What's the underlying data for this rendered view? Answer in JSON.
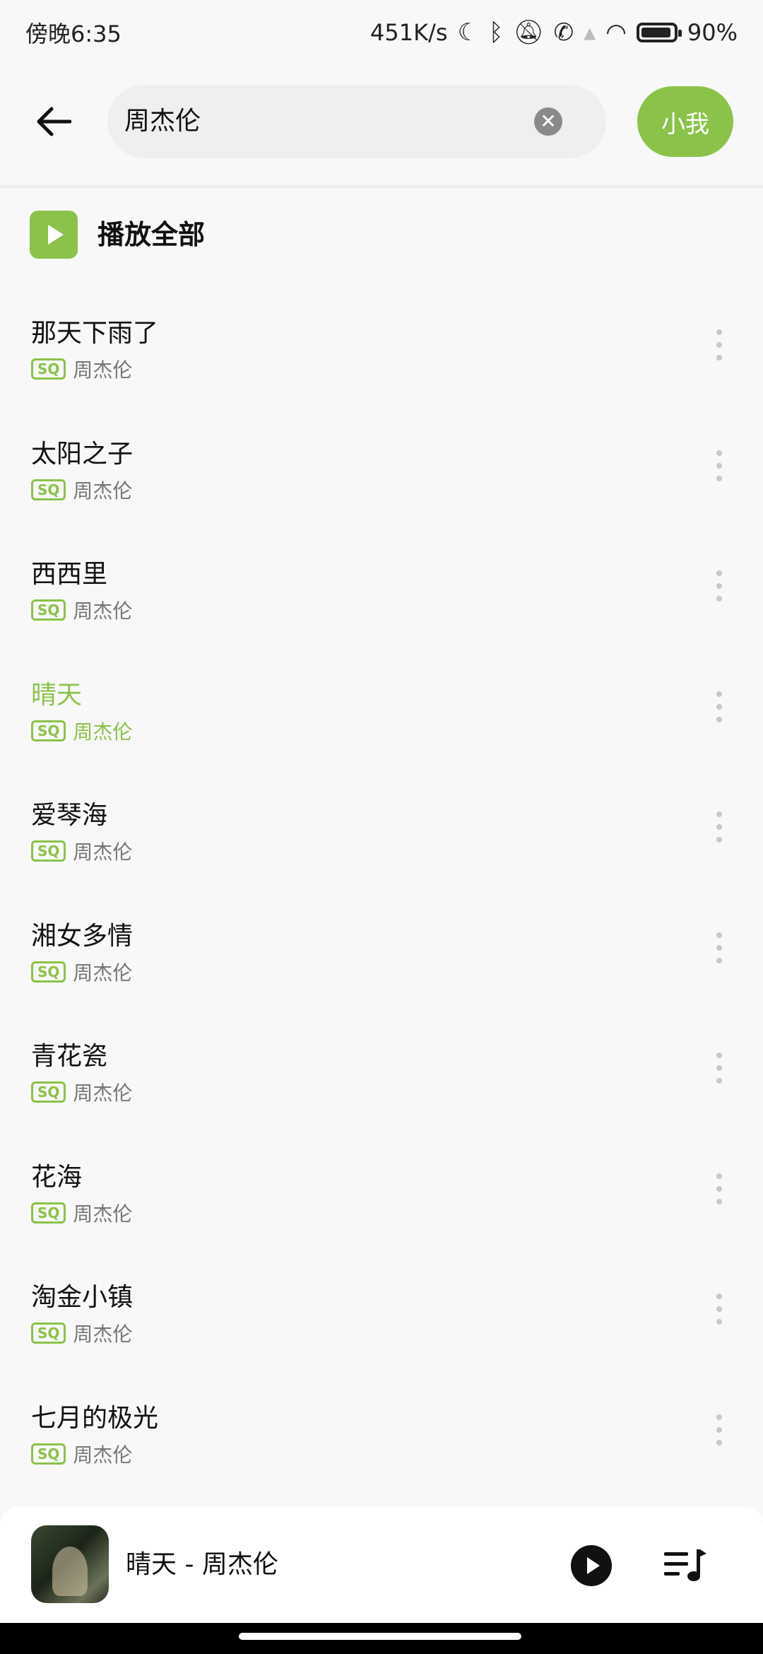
{
  "status_bar": {
    "time": "傍晚6:35",
    "network_speed": "451K/s",
    "battery": "90%"
  },
  "header": {
    "search_value": "周杰伦",
    "search_button": "小我"
  },
  "play_all": {
    "label": "播放全部"
  },
  "songs": [
    {
      "title": "那天下雨了",
      "quality": "SQ",
      "artist": "周杰伦"
    },
    {
      "title": "太阳之子",
      "quality": "SQ",
      "artist": "周杰伦"
    },
    {
      "title": "西西里",
      "quality": "SQ",
      "artist": "周杰伦"
    },
    {
      "title": "晴天",
      "quality": "SQ",
      "artist": "周杰伦"
    },
    {
      "title": "爱琴海",
      "quality": "SQ",
      "artist": "周杰伦"
    },
    {
      "title": "湘女多情",
      "quality": "SQ",
      "artist": "周杰伦"
    },
    {
      "title": "青花瓷",
      "quality": "SQ",
      "artist": "周杰伦"
    },
    {
      "title": "花海",
      "quality": "SQ",
      "artist": "周杰伦"
    },
    {
      "title": "淘金小镇",
      "quality": "SQ",
      "artist": "周杰伦"
    },
    {
      "title": "七月的极光",
      "quality": "SQ",
      "artist": "周杰伦"
    }
  ],
  "now_playing": {
    "title": "晴天 - 周杰伦"
  },
  "colors": {
    "accent": "#8bc34a"
  }
}
